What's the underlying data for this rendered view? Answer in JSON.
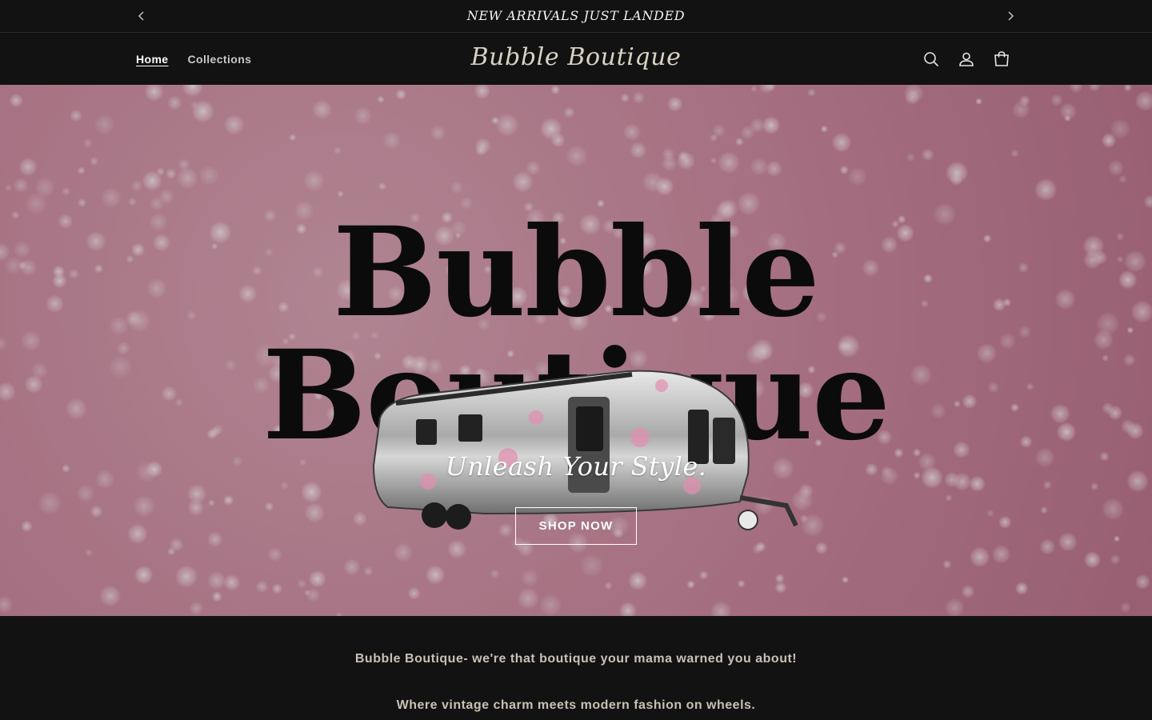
{
  "announcement": {
    "message": "NEW ARRIVALS JUST LANDED",
    "prev_icon": "chevron-left-icon",
    "next_icon": "chevron-right-icon"
  },
  "header": {
    "nav": [
      {
        "label": "Home",
        "active": true
      },
      {
        "label": "Collections",
        "active": false
      }
    ],
    "logo": "Bubble Boutique",
    "icons": [
      "search-icon",
      "account-icon",
      "cart-icon"
    ]
  },
  "hero": {
    "title": "Bubble Boutique",
    "tagline": "Unleash Your Style.",
    "button_label": "SHOP NOW",
    "colors": {
      "background": "#c9879d",
      "title": "#0b0b0b"
    }
  },
  "intro": {
    "line1": "Bubble Boutique- we're that boutique your mama warned you about!",
    "line2": "Where vintage charm meets modern fashion on wheels."
  }
}
